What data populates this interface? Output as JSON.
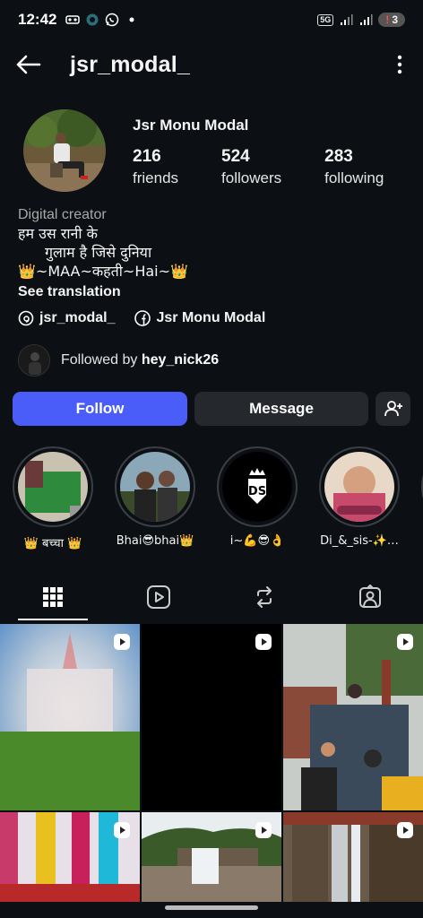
{
  "status_bar": {
    "time": "12:42",
    "network": "5G",
    "battery_alert": "!",
    "battery_level": "3"
  },
  "header": {
    "username": "jsr_modal_"
  },
  "profile": {
    "display_name": "Jsr Monu Modal",
    "stats": [
      {
        "number": "216",
        "label": "friends"
      },
      {
        "number": "524",
        "label": "followers"
      },
      {
        "number": "283",
        "label": "following"
      }
    ],
    "category": "Digital creator",
    "bio_lines": [
      "हम उस रानी के",
      "गुलाम है जिसे दुनिया",
      "👑~MAA~कहती~Hai~👑"
    ],
    "see_translation": "See translation",
    "threads_handle": "jsr_modal_",
    "facebook_name": "Jsr Monu Modal",
    "followed_by_prefix": "Followed by",
    "followed_by_user": "hey_nick26"
  },
  "actions": {
    "follow": "Follow",
    "message": "Message"
  },
  "highlights": [
    {
      "label": "👑 बच्चा 👑"
    },
    {
      "label": "Bhai😎bhai👑"
    },
    {
      "label": "i~💪😎👌"
    },
    {
      "label": "Di_&_sis-✨…"
    }
  ],
  "tabs": [
    {
      "icon": "grid-icon",
      "active": true
    },
    {
      "icon": "reels-icon",
      "active": false
    },
    {
      "icon": "repost-icon",
      "active": false
    },
    {
      "icon": "tagged-icon",
      "active": false
    }
  ],
  "colors": {
    "background": "#0c1014",
    "follow_button": "#4a5df9",
    "secondary_button": "#25292e",
    "muted_text": "#a8a8a8"
  }
}
